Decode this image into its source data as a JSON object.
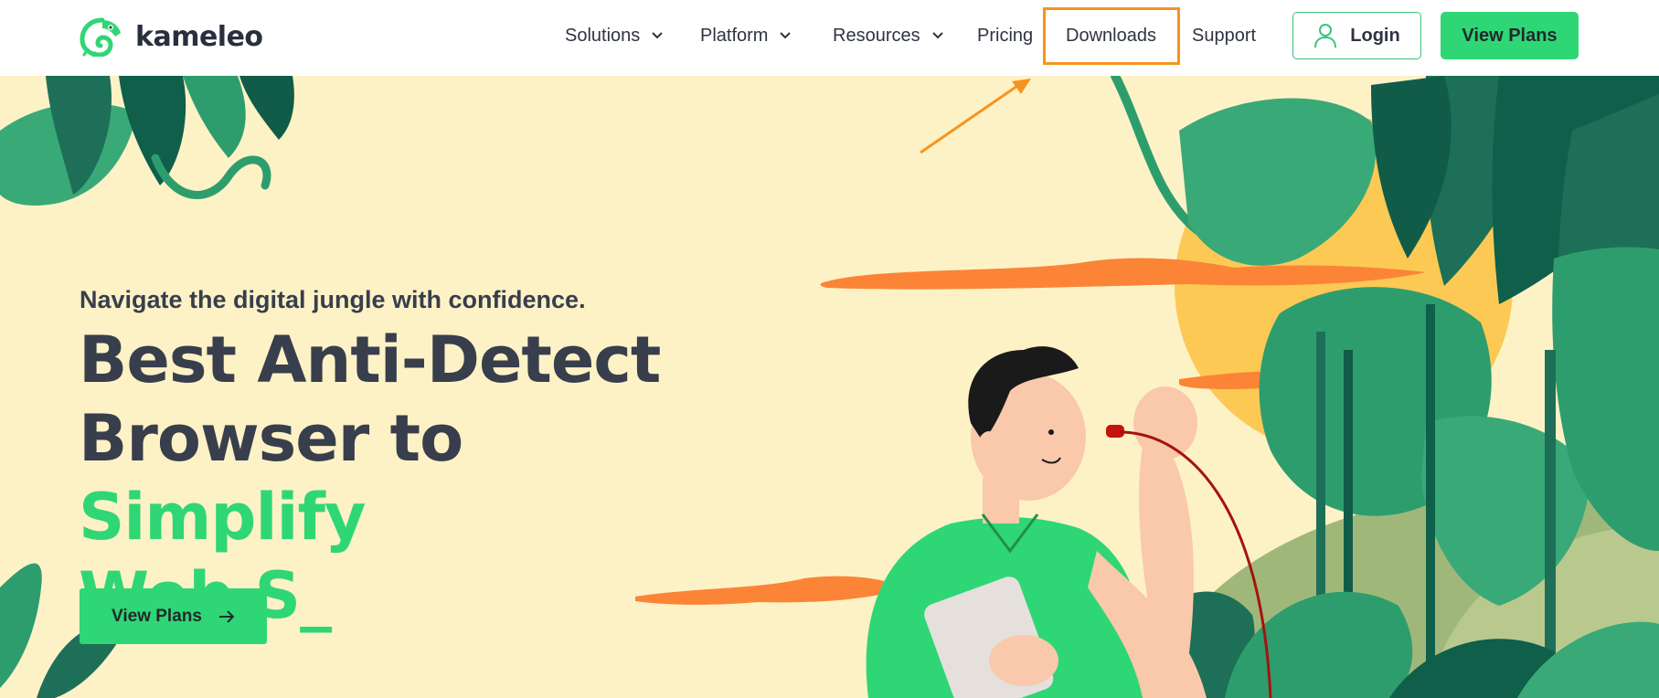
{
  "brand": {
    "name": "kameleo",
    "logo_icon": "chameleon-logo-icon",
    "accent": "#2fd675"
  },
  "nav": {
    "items": [
      {
        "label": "Solutions",
        "has_dropdown": true
      },
      {
        "label": "Platform",
        "has_dropdown": true
      },
      {
        "label": "Resources",
        "has_dropdown": true
      },
      {
        "label": "Pricing",
        "has_dropdown": false
      },
      {
        "label": "Downloads",
        "has_dropdown": false,
        "highlighted": true
      },
      {
        "label": "Support",
        "has_dropdown": false
      }
    ],
    "login_label": "Login",
    "view_plans_label": "View Plans"
  },
  "hero": {
    "tagline": "Navigate the digital jungle with confidence.",
    "headline_line1": "Best Anti-Detect",
    "headline_line2_dark": "Browser to ",
    "headline_line2_green": "Simplify",
    "headline_line3": "Web S_",
    "cta_label": "View Plans",
    "cta_icon": "arrow-right-icon",
    "background": "#fdf2c6"
  },
  "annotation": {
    "highlight_color": "#f7931e",
    "target": "Downloads"
  }
}
